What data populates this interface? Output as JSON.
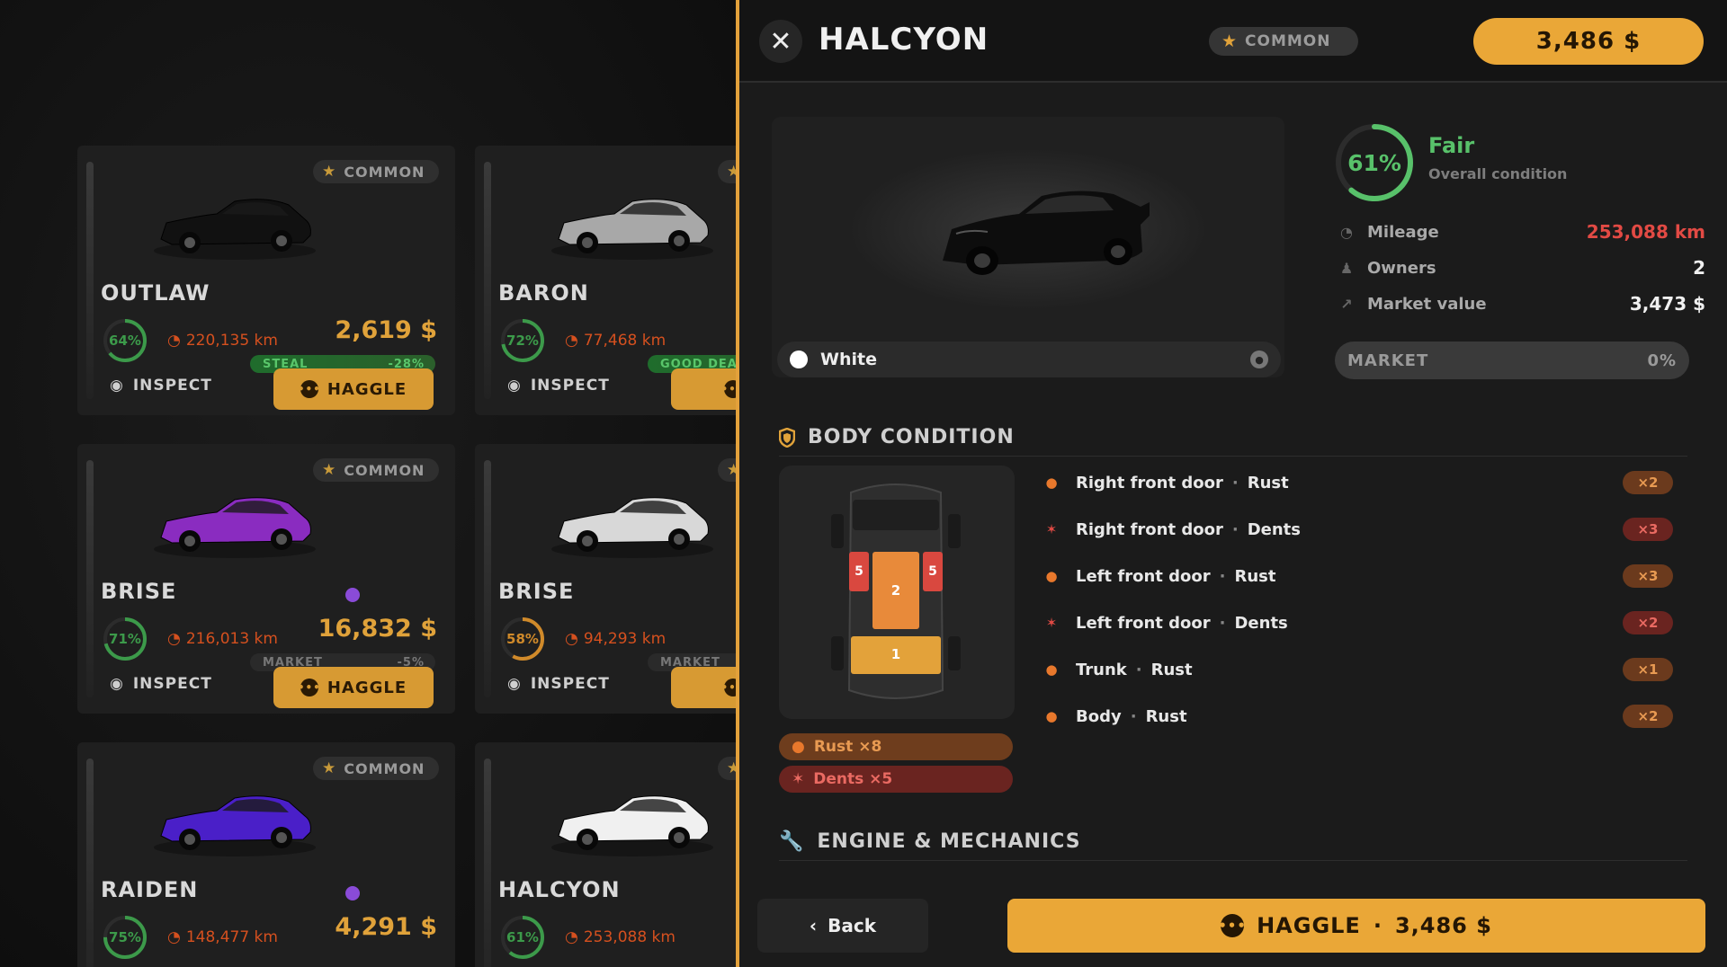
{
  "listing": {
    "cards": [
      {
        "rarity": "COMMON",
        "name": "OUTLAW",
        "condition": "64%",
        "condition_value": 0.64,
        "mileage": "220,135 km",
        "price": "2,619 $",
        "deal_label": "STEAL",
        "deal_pct": "-28%",
        "deal_style": "green",
        "inspect": "INSPECT",
        "haggle": "HAGGLE",
        "body_color": "#111111",
        "ring_color": "#3c9a4a",
        "dot": false
      },
      {
        "rarity": "",
        "name": "BARON",
        "condition": "72%",
        "condition_value": 0.72,
        "mileage": "77,468 km",
        "price": "",
        "deal_label": "GOOD DEA",
        "deal_pct": "",
        "deal_style": "green",
        "inspect": "INSPECT",
        "haggle": "HA",
        "body_color": "#a8a8a8",
        "ring_color": "#3c9a4a",
        "dot": false
      },
      {
        "rarity": "COMMON",
        "name": "BRISE",
        "condition": "71%",
        "condition_value": 0.71,
        "mileage": "216,013 km",
        "price": "16,832 $",
        "deal_label": "MARKET",
        "deal_pct": "-5%",
        "deal_style": "gray",
        "inspect": "INSPECT",
        "haggle": "HAGGLE",
        "body_color": "#8a2cc0",
        "ring_color": "#3c9a4a",
        "dot": true
      },
      {
        "rarity": "",
        "name": "BRISE",
        "condition": "58%",
        "condition_value": 0.58,
        "mileage": "94,293 km",
        "price": "1",
        "deal_label": "MARKET",
        "deal_pct": "",
        "deal_style": "gray",
        "inspect": "INSPECT",
        "haggle": "HA",
        "body_color": "#d8d8d8",
        "ring_color": "#d08a2a",
        "dot": false
      },
      {
        "rarity": "COMMON",
        "name": "RAIDEN",
        "condition": "75%",
        "condition_value": 0.75,
        "mileage": "148,477 km",
        "price": "4,291 $",
        "deal_label": "",
        "deal_pct": "",
        "deal_style": "gray",
        "inspect": "",
        "haggle": "",
        "body_color": "#4a1fc8",
        "ring_color": "#3c9a4a",
        "dot": true
      },
      {
        "rarity": "",
        "name": "HALCYON",
        "condition": "61%",
        "condition_value": 0.61,
        "mileage": "253,088 km",
        "price": "",
        "deal_label": "",
        "deal_pct": "",
        "deal_style": "gray",
        "inspect": "",
        "haggle": "",
        "body_color": "#f0f0f0",
        "ring_color": "#3c9a4a",
        "dot": false
      }
    ]
  },
  "detail": {
    "title": "HALCYON",
    "rarity": "COMMON",
    "price": "3,486 $",
    "color_name": "White",
    "condition_pct": "61%",
    "condition_value": 0.61,
    "condition_label": "Fair",
    "condition_sub": "Overall condition",
    "stats": [
      {
        "icon": "speedometer-icon",
        "label": "Mileage",
        "value": "253,088 km",
        "style": "red"
      },
      {
        "icon": "owners-icon",
        "label": "Owners",
        "value": "2",
        "style": ""
      },
      {
        "icon": "chart-icon",
        "label": "Market value",
        "value": "3,473 $",
        "style": ""
      }
    ],
    "market_label": "MARKET",
    "market_pct": "0%",
    "body_section": "BODY CONDITION",
    "diagram": {
      "seat_front": "1",
      "seat_middle": "2",
      "door_left": "5",
      "door_right": "5"
    },
    "rust_summary": "Rust  ×8",
    "dent_summary": "Dents  ×5",
    "damages": [
      {
        "part": "Right front door",
        "type": "Rust",
        "count": "×2",
        "kind": "rust"
      },
      {
        "part": "Right front door",
        "type": "Dents",
        "count": "×3",
        "kind": "dent"
      },
      {
        "part": "Left front door",
        "type": "Rust",
        "count": "×3",
        "kind": "rust"
      },
      {
        "part": "Left front door",
        "type": "Dents",
        "count": "×2",
        "kind": "dent"
      },
      {
        "part": "Trunk",
        "type": "Rust",
        "count": "×1",
        "kind": "rust"
      },
      {
        "part": "Body",
        "type": "Rust",
        "count": "×2",
        "kind": "rust"
      }
    ],
    "engine_section": "ENGINE & MECHANICS",
    "back_label": "Back",
    "haggle_label": "HAGGLE",
    "haggle_price": "3,486 $"
  },
  "colors": {
    "accent": "#eaa737",
    "good": "#58c16a",
    "bad": "#e24a44"
  }
}
